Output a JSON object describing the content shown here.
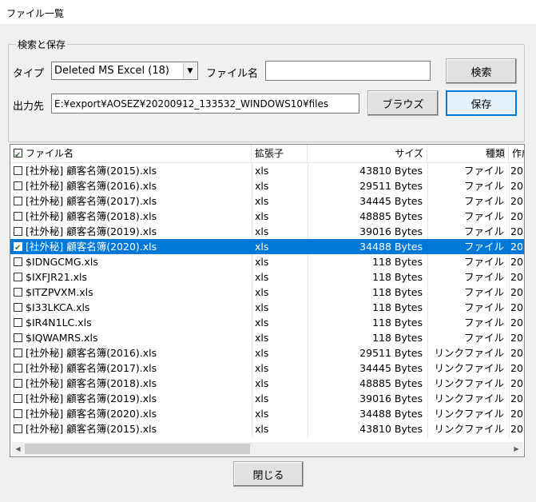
{
  "window": {
    "title": "ファイル一覧"
  },
  "group": {
    "label": "検索と保存"
  },
  "form": {
    "type_label": "タイプ",
    "type_value": "Deleted MS Excel (18)",
    "filename_label": "ファイル名",
    "filename_value": "",
    "output_label": "出力先",
    "output_value": "E:¥export¥AOSEZ¥20200912_133532_WINDOWS10¥files",
    "search_button": "検索",
    "browse_button": "ブラウズ",
    "save_button": "保存"
  },
  "table": {
    "headers": {
      "name": "ファイル名",
      "ext": "拡張子",
      "size": "サイズ",
      "type": "種類",
      "date": "作成"
    },
    "rows": [
      {
        "name": "[社外秘] 顧客名簿(2015).xls",
        "ext": "xls",
        "size": "43810 Bytes",
        "type": "ファイル",
        "date": "20",
        "checked": false,
        "selected": false
      },
      {
        "name": "[社外秘] 顧客名簿(2016).xls",
        "ext": "xls",
        "size": "29511 Bytes",
        "type": "ファイル",
        "date": "20",
        "checked": false,
        "selected": false
      },
      {
        "name": "[社外秘] 顧客名簿(2017).xls",
        "ext": "xls",
        "size": "34445 Bytes",
        "type": "ファイル",
        "date": "20",
        "checked": false,
        "selected": false
      },
      {
        "name": "[社外秘] 顧客名簿(2018).xls",
        "ext": "xls",
        "size": "48885 Bytes",
        "type": "ファイル",
        "date": "20",
        "checked": false,
        "selected": false
      },
      {
        "name": "[社外秘] 顧客名簿(2019).xls",
        "ext": "xls",
        "size": "39016 Bytes",
        "type": "ファイル",
        "date": "20",
        "checked": false,
        "selected": false
      },
      {
        "name": "[社外秘] 顧客名簿(2020).xls",
        "ext": "xls",
        "size": "34488 Bytes",
        "type": "ファイル",
        "date": "20",
        "checked": true,
        "selected": true
      },
      {
        "name": "$IDNGCMG.xls",
        "ext": "xls",
        "size": "118 Bytes",
        "type": "ファイル",
        "date": "20",
        "checked": false,
        "selected": false
      },
      {
        "name": "$IXFJR21.xls",
        "ext": "xls",
        "size": "118 Bytes",
        "type": "ファイル",
        "date": "20",
        "checked": false,
        "selected": false
      },
      {
        "name": "$ITZPVXM.xls",
        "ext": "xls",
        "size": "118 Bytes",
        "type": "ファイル",
        "date": "20",
        "checked": false,
        "selected": false
      },
      {
        "name": "$I33LKCA.xls",
        "ext": "xls",
        "size": "118 Bytes",
        "type": "ファイル",
        "date": "20",
        "checked": false,
        "selected": false
      },
      {
        "name": "$IR4N1LC.xls",
        "ext": "xls",
        "size": "118 Bytes",
        "type": "ファイル",
        "date": "20",
        "checked": false,
        "selected": false
      },
      {
        "name": "$IQWAMRS.xls",
        "ext": "xls",
        "size": "118 Bytes",
        "type": "ファイル",
        "date": "20",
        "checked": false,
        "selected": false
      },
      {
        "name": "[社外秘] 顧客名簿(2016).xls",
        "ext": "xls",
        "size": "29511 Bytes",
        "type": "リンクファイル",
        "date": "20",
        "checked": false,
        "selected": false
      },
      {
        "name": "[社外秘] 顧客名簿(2017).xls",
        "ext": "xls",
        "size": "34445 Bytes",
        "type": "リンクファイル",
        "date": "20",
        "checked": false,
        "selected": false
      },
      {
        "name": "[社外秘] 顧客名簿(2018).xls",
        "ext": "xls",
        "size": "48885 Bytes",
        "type": "リンクファイル",
        "date": "20",
        "checked": false,
        "selected": false
      },
      {
        "name": "[社外秘] 顧客名簿(2019).xls",
        "ext": "xls",
        "size": "39016 Bytes",
        "type": "リンクファイル",
        "date": "20",
        "checked": false,
        "selected": false
      },
      {
        "name": "[社外秘] 顧客名簿(2020).xls",
        "ext": "xls",
        "size": "34488 Bytes",
        "type": "リンクファイル",
        "date": "20",
        "checked": false,
        "selected": false
      },
      {
        "name": "[社外秘] 顧客名簿(2015).xls",
        "ext": "xls",
        "size": "43810 Bytes",
        "type": "リンクファイル",
        "date": "20",
        "checked": false,
        "selected": false
      }
    ]
  },
  "footer": {
    "close_button": "閉じる"
  },
  "icons": {
    "dropdown": "chevron-down-icon",
    "scroll_left": "arrow-left-icon",
    "scroll_right": "arrow-right-icon",
    "checkbox": "checkbox-icon"
  },
  "colors": {
    "selection": "#0078d7",
    "default_button_border": "#0078d7"
  }
}
